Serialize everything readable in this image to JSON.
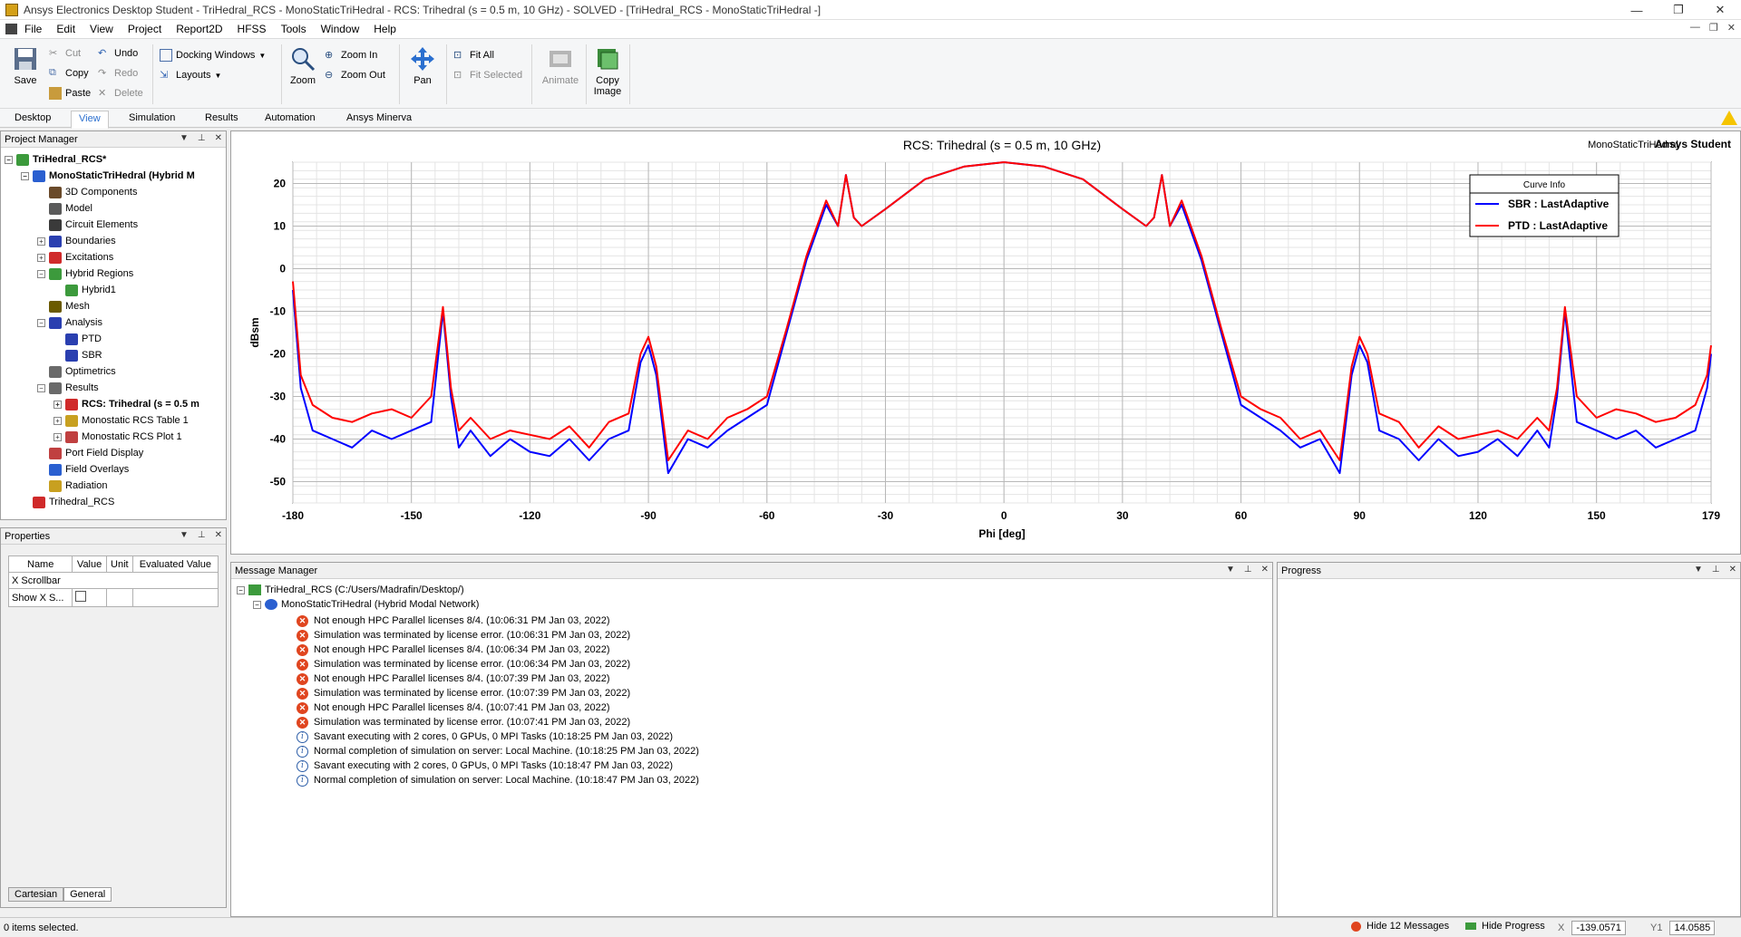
{
  "window": {
    "title": "Ansys Electronics Desktop Student - TriHedral_RCS - MonoStaticTriHedral - RCS: Trihedral (s = 0.5 m, 10 GHz) - SOLVED - [TriHedral_RCS - MonoStaticTriHedral -]",
    "minimize": "—",
    "restore": "❐",
    "close": "✕"
  },
  "menu": [
    "File",
    "Edit",
    "View",
    "Project",
    "Report2D",
    "HFSS",
    "Tools",
    "Window",
    "Help"
  ],
  "ribbon": {
    "save": "Save",
    "cut": "Cut",
    "copy": "Copy",
    "paste": "Paste",
    "undo": "Undo",
    "redo": "Redo",
    "delete": "Delete",
    "docking": "Docking Windows",
    "layouts": "Layouts",
    "zoom": "Zoom",
    "zoom_in": "Zoom In",
    "zoom_out": "Zoom Out",
    "pan": "Pan",
    "fit_all": "Fit All",
    "fit_selected": "Fit Selected",
    "animate": "Animate",
    "copy_image": "Copy Image"
  },
  "tabs": [
    "Desktop",
    "View",
    "Simulation",
    "Results",
    "Automation",
    "Ansys Minerva"
  ],
  "active_tab": "View",
  "project_manager": {
    "title": "Project Manager",
    "items": [
      {
        "label": "TriHedral_RCS*",
        "bold": true
      },
      {
        "label": "MonoStaticTriHedral (Hybrid M",
        "bold": true
      },
      {
        "label": "3D Components"
      },
      {
        "label": "Model"
      },
      {
        "label": "Circuit Elements"
      },
      {
        "label": "Boundaries"
      },
      {
        "label": "Excitations"
      },
      {
        "label": "Hybrid Regions"
      },
      {
        "label": "Hybrid1"
      },
      {
        "label": "Mesh"
      },
      {
        "label": "Analysis"
      },
      {
        "label": "PTD"
      },
      {
        "label": "SBR"
      },
      {
        "label": "Optimetrics"
      },
      {
        "label": "Results"
      },
      {
        "label": "RCS: Trihedral (s = 0.5 m",
        "bold": true
      },
      {
        "label": "Monostatic RCS Table 1"
      },
      {
        "label": "Monostatic RCS Plot 1"
      },
      {
        "label": "Port Field Display"
      },
      {
        "label": "Field Overlays"
      },
      {
        "label": "Radiation"
      },
      {
        "label": "Trihedral_RCS"
      }
    ]
  },
  "properties": {
    "title": "Properties",
    "columns": [
      "Name",
      "Value",
      "Unit",
      "Evaluated Value"
    ],
    "group": "X Scrollbar",
    "row_name": "Show X S...",
    "tabs": [
      "Cartesian",
      "General"
    ]
  },
  "plot": {
    "title": "RCS: Trihedral (s = 0.5 m, 10 GHz)",
    "design": "MonoStaticTriHedral",
    "brand": "Ansys Student",
    "legend_title": "Curve Info",
    "colors": {
      "sbr": "#0000ff",
      "ptd": "#ff0000"
    }
  },
  "chart_data": {
    "type": "line",
    "title": "RCS: Trihedral (s = 0.5 m, 10 GHz)",
    "xlabel": "Phi [deg]",
    "ylabel": "dBsm",
    "xlim": [
      -180,
      179
    ],
    "ylim": [
      -55,
      25
    ],
    "x_ticks": [
      "-180",
      "-150",
      "-120",
      "-90",
      "-60",
      "-30",
      "0",
      "30",
      "60",
      "90",
      "120",
      "150",
      "179"
    ],
    "y_ticks": [
      "20",
      "10",
      "0",
      "-10",
      "-20",
      "-30",
      "-40",
      "-50"
    ],
    "grid": true,
    "legend_position": "top-right",
    "series": [
      {
        "name": "SBR : LastAdaptive",
        "color": "#0000ff",
        "x": [
          -180,
          -178,
          -175,
          -170,
          -165,
          -160,
          -155,
          -150,
          -145,
          -142,
          -140,
          -138,
          -135,
          -130,
          -125,
          -120,
          -115,
          -110,
          -105,
          -100,
          -95,
          -92,
          -90,
          -88,
          -85,
          -80,
          -75,
          -70,
          -65,
          -60,
          -55,
          -50,
          -45,
          -42,
          -40,
          -38,
          -36,
          -30,
          -20,
          -10,
          0,
          10,
          20,
          30,
          36,
          38,
          40,
          42,
          45,
          50,
          55,
          60,
          65,
          70,
          75,
          80,
          85,
          88,
          90,
          92,
          95,
          100,
          105,
          110,
          115,
          120,
          125,
          130,
          135,
          138,
          140,
          142,
          145,
          150,
          155,
          160,
          165,
          170,
          175,
          178,
          179
        ],
        "y": [
          -5,
          -28,
          -38,
          -40,
          -42,
          -38,
          -40,
          -38,
          -36,
          -10,
          -30,
          -42,
          -38,
          -44,
          -40,
          -43,
          -44,
          -40,
          -45,
          -40,
          -38,
          -22,
          -18,
          -25,
          -48,
          -40,
          -42,
          -38,
          -35,
          -32,
          -15,
          2,
          15,
          10,
          22,
          12,
          10,
          14,
          21,
          24,
          25,
          24,
          21,
          14,
          10,
          12,
          22,
          10,
          15,
          2,
          -15,
          -32,
          -35,
          -38,
          -42,
          -40,
          -48,
          -25,
          -18,
          -22,
          -38,
          -40,
          -45,
          -40,
          -44,
          -43,
          -40,
          -44,
          -38,
          -42,
          -30,
          -10,
          -36,
          -38,
          -40,
          -38,
          -42,
          -40,
          -38,
          -28,
          -20
        ]
      },
      {
        "name": "PTD : LastAdaptive",
        "color": "#ff0000",
        "x": [
          -180,
          -178,
          -175,
          -170,
          -165,
          -160,
          -155,
          -150,
          -145,
          -142,
          -140,
          -138,
          -135,
          -130,
          -125,
          -120,
          -115,
          -110,
          -105,
          -100,
          -95,
          -92,
          -90,
          -88,
          -85,
          -80,
          -75,
          -70,
          -65,
          -60,
          -55,
          -50,
          -45,
          -42,
          -40,
          -38,
          -36,
          -30,
          -20,
          -10,
          0,
          10,
          20,
          30,
          36,
          38,
          40,
          42,
          45,
          50,
          55,
          60,
          65,
          70,
          75,
          80,
          85,
          88,
          90,
          92,
          95,
          100,
          105,
          110,
          115,
          120,
          125,
          130,
          135,
          138,
          140,
          142,
          145,
          150,
          155,
          160,
          165,
          170,
          175,
          178,
          179
        ],
        "y": [
          -3,
          -25,
          -32,
          -35,
          -36,
          -34,
          -33,
          -35,
          -30,
          -9,
          -28,
          -38,
          -35,
          -40,
          -38,
          -39,
          -40,
          -37,
          -42,
          -36,
          -34,
          -20,
          -16,
          -23,
          -45,
          -38,
          -40,
          -35,
          -33,
          -30,
          -14,
          3,
          16,
          10,
          22,
          12,
          10,
          14,
          21,
          24,
          25,
          24,
          21,
          14,
          10,
          12,
          22,
          10,
          16,
          3,
          -14,
          -30,
          -33,
          -35,
          -40,
          -38,
          -45,
          -23,
          -16,
          -20,
          -34,
          -36,
          -42,
          -37,
          -40,
          -39,
          -38,
          -40,
          -35,
          -38,
          -28,
          -9,
          -30,
          -35,
          -33,
          -34,
          -36,
          -35,
          -32,
          -25,
          -18
        ]
      }
    ]
  },
  "messages": {
    "title": "Message Manager",
    "project": "TriHedral_RCS (C:/Users/Madrafin/Desktop/)",
    "design": "MonoStaticTriHedral (Hybrid Modal Network)",
    "lines": [
      {
        "type": "error",
        "text": "Not enough HPC Parallel licenses 8/4.  (10:06:31 PM  Jan 03, 2022)"
      },
      {
        "type": "error",
        "text": "Simulation was terminated by license error. (10:06:31 PM  Jan 03, 2022)"
      },
      {
        "type": "error",
        "text": "Not enough HPC Parallel licenses 8/4.  (10:06:34 PM  Jan 03, 2022)"
      },
      {
        "type": "error",
        "text": "Simulation was terminated by license error. (10:06:34 PM  Jan 03, 2022)"
      },
      {
        "type": "error",
        "text": "Not enough HPC Parallel licenses 8/4.  (10:07:39 PM  Jan 03, 2022)"
      },
      {
        "type": "error",
        "text": "Simulation was terminated by license error. (10:07:39 PM  Jan 03, 2022)"
      },
      {
        "type": "error",
        "text": "Not enough HPC Parallel licenses 8/4.  (10:07:41 PM  Jan 03, 2022)"
      },
      {
        "type": "error",
        "text": "Simulation was terminated by license error. (10:07:41 PM  Jan 03, 2022)"
      },
      {
        "type": "info",
        "text": "Savant executing with 2 cores, 0 GPUs, 0 MPI Tasks (10:18:25 PM  Jan 03, 2022)"
      },
      {
        "type": "info",
        "text": "Normal completion of simulation on server: Local Machine. (10:18:25 PM  Jan 03, 2022)"
      },
      {
        "type": "info",
        "text": "Savant executing with 2 cores, 0 GPUs, 0 MPI Tasks (10:18:47 PM  Jan 03, 2022)"
      },
      {
        "type": "info",
        "text": "Normal completion of simulation on server: Local Machine. (10:18:47 PM  Jan 03, 2022)"
      }
    ]
  },
  "progress": {
    "title": "Progress"
  },
  "status": {
    "selected": "0 items selected.",
    "hide_messages": "Hide 12 Messages",
    "hide_progress": "Hide Progress",
    "x_label": "X",
    "x_value": "-139.0571",
    "y_label": "Y1",
    "y_value": "14.0585"
  }
}
